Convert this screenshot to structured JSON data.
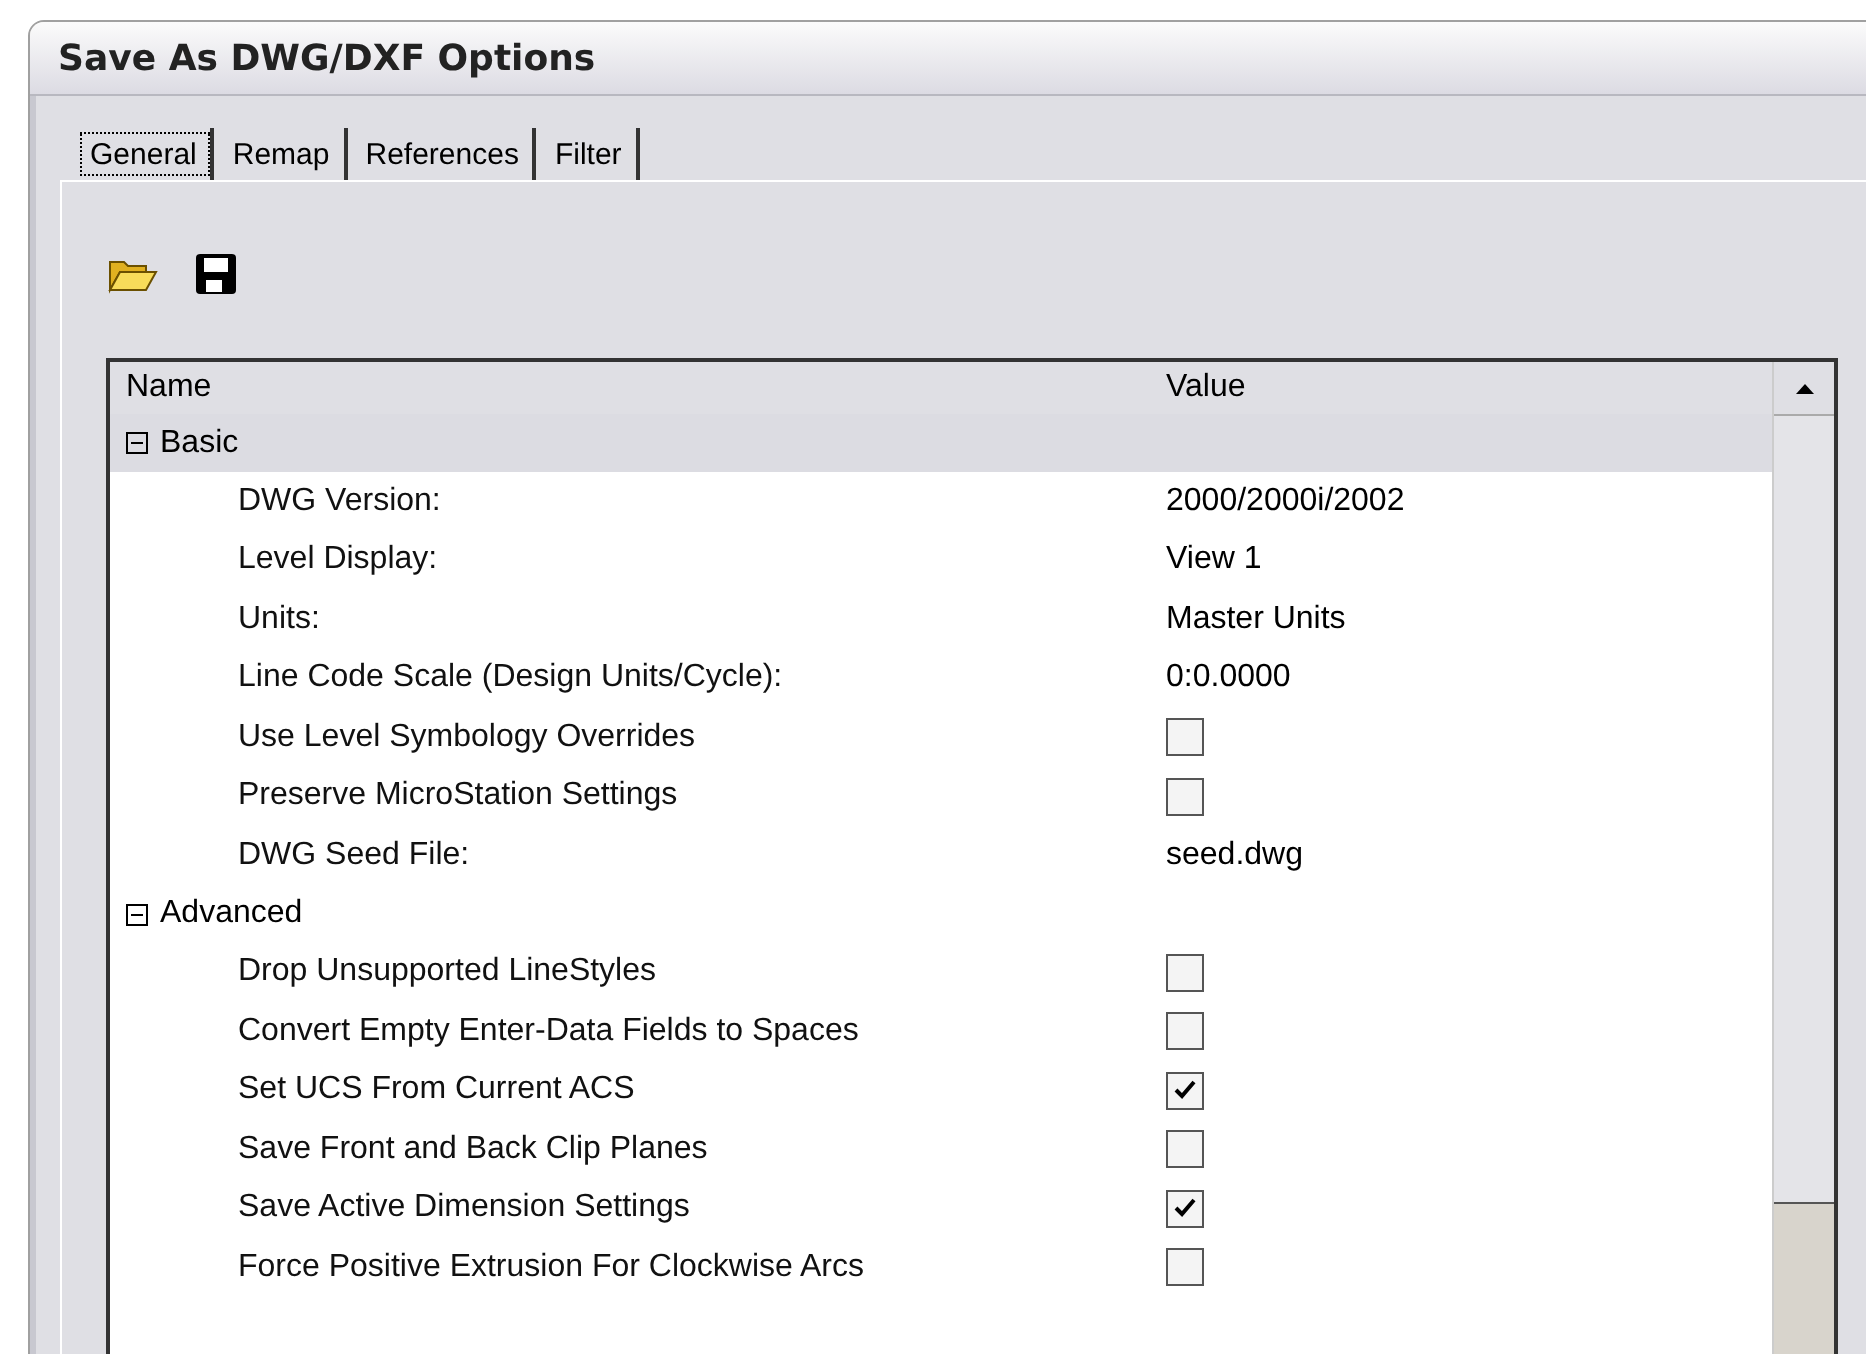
{
  "window": {
    "title": "Save As DWG/DXF Options"
  },
  "tabs": [
    {
      "label": "General",
      "selected": true
    },
    {
      "label": "Remap",
      "selected": false
    },
    {
      "label": "References",
      "selected": false
    },
    {
      "label": "Filter",
      "selected": false
    }
  ],
  "table": {
    "columns": [
      "Name",
      "Value"
    ],
    "groups": [
      {
        "label": "Basic",
        "expanded": true,
        "selected": true,
        "rows": [
          {
            "kind": "text",
            "name": "DWG Version:",
            "value": "2000/2000i/2002"
          },
          {
            "kind": "text",
            "name": "Level Display:",
            "value": "View 1"
          },
          {
            "kind": "text",
            "name": "Units:",
            "value": "Master Units"
          },
          {
            "kind": "text",
            "name": "Line Code Scale (Design Units/Cycle):",
            "value": "0:0.0000"
          },
          {
            "kind": "checkbox",
            "name": "Use Level Symbology Overrides",
            "checked": false
          },
          {
            "kind": "checkbox",
            "name": "Preserve MicroStation Settings",
            "checked": false
          },
          {
            "kind": "text",
            "name": "DWG Seed File:",
            "value": "seed.dwg"
          }
        ]
      },
      {
        "label": "Advanced",
        "expanded": true,
        "selected": false,
        "rows": [
          {
            "kind": "checkbox",
            "name": "Drop Unsupported LineStyles",
            "checked": false
          },
          {
            "kind": "checkbox",
            "name": "Convert Empty Enter-Data Fields to Spaces",
            "checked": false
          },
          {
            "kind": "checkbox",
            "name": "Set UCS From Current ACS",
            "checked": true
          },
          {
            "kind": "checkbox",
            "name": "Save Front and Back Clip Planes",
            "checked": false
          },
          {
            "kind": "checkbox",
            "name": "Save Active Dimension Settings",
            "checked": true
          },
          {
            "kind": "checkbox",
            "name": "Force Positive Extrusion For Clockwise Arcs",
            "checked": false
          }
        ]
      }
    ]
  }
}
